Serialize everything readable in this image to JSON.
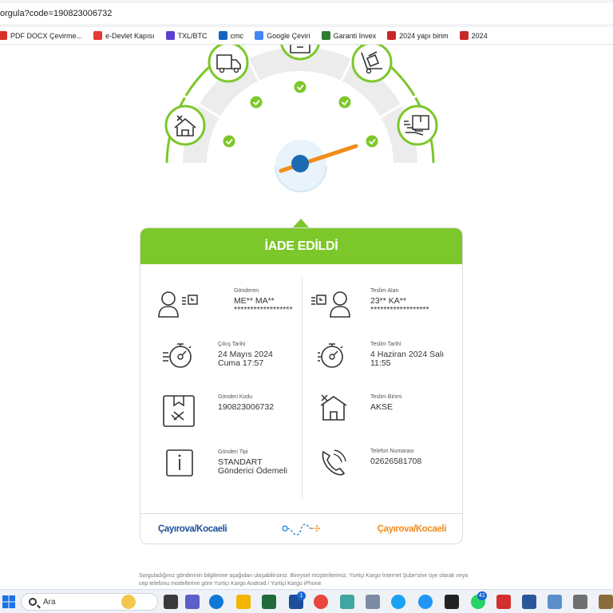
{
  "browser": {
    "url": "orgula?code=190823006732",
    "bookmarks": [
      {
        "label": "PDF DOCX Çevirme...",
        "color": "#d93025"
      },
      {
        "label": "e-Devlet Kapısı",
        "color": "#e53935"
      },
      {
        "label": "TXL/BTC",
        "color": "#5b3fd1"
      },
      {
        "label": "cmc",
        "color": "#1565c0"
      },
      {
        "label": "Google Çeviri",
        "color": "#4285f4"
      },
      {
        "label": "Garanti Invex",
        "color": "#2e7d32"
      },
      {
        "label": "2024 yapı birim",
        "color": "#c62828"
      },
      {
        "label": "2024",
        "color": "#c62828"
      }
    ]
  },
  "colors": {
    "green": "#7cc72a",
    "orange": "#f28c1a",
    "blue": "#1c4e9c"
  },
  "gauge": {
    "steps": [
      {
        "icon": "warehouse-icon",
        "done": true
      },
      {
        "icon": "truck-icon",
        "done": true
      },
      {
        "icon": "box-icon",
        "done": true
      },
      {
        "icon": "hand-truck-icon",
        "done": true
      },
      {
        "icon": "delivered-package-icon",
        "done": true
      }
    ]
  },
  "card": {
    "status": "İADE EDİLDİ",
    "left": [
      {
        "icon": "sender-person-icon",
        "label": "Gönderen",
        "value": "ME** MA**",
        "value2": "******************"
      },
      {
        "icon": "stopwatch-icon",
        "label": "Çıkış Tarihi",
        "value": "24 Mayıs 2024",
        "value2": "Cuma 17:57"
      },
      {
        "icon": "package-icon",
        "label": "Gönderi Kodu",
        "value": "190823006732",
        "value2": ""
      },
      {
        "icon": "info-icon",
        "label": "Gönderi Tipi",
        "value": "STANDART",
        "value2": "Gönderici Ödemeli"
      }
    ],
    "right": [
      {
        "icon": "receiver-person-icon",
        "label": "Teslim Alan",
        "value": "23** KA**",
        "value2": "******************"
      },
      {
        "icon": "stopwatch-icon",
        "label": "Teslim Tarihi",
        "value": "4 Haziran 2024 Salı",
        "value2": "11:55"
      },
      {
        "icon": "branch-icon",
        "label": "Teslim Birimi",
        "value": "AKSE",
        "value2": ""
      },
      {
        "icon": "phone-icon",
        "label": "Telefon Numarası",
        "value": "02626581708",
        "value2": ""
      }
    ],
    "from": "Çayırova/Kocaeli",
    "to": "Çayırova/Kocaeli"
  },
  "footnote": "Sorguladığınız gönderinin bilgilerine aşağıdan ulaşabilirsiniz. Bireysel müşterilerimiz, Yurtiçi Kargo İnternet Şube'sine üye olarak veya cep telefonu modellerine göre Yurtiçi Kargo Android / Yurtiçi Kargo iPhone",
  "taskbar": {
    "search_label": "Ara",
    "badges": {
      "mail": "1",
      "whatsapp": "41"
    }
  }
}
